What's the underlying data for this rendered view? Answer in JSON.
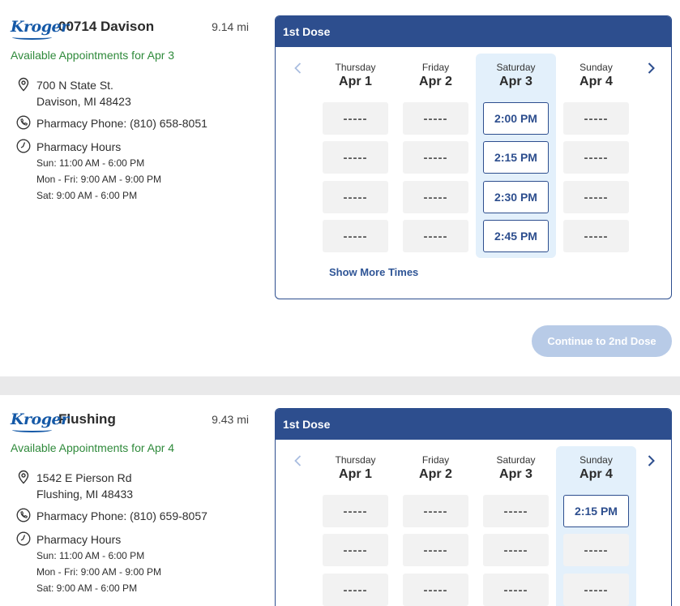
{
  "stores": [
    {
      "name": "00714 Davison",
      "distance": "9.14 mi",
      "available": "Available Appointments for Apr 3",
      "address_line1": "700 N State St.",
      "address_line2": "Davison, MI 48423",
      "phone": "Pharmacy Phone: (810) 658-8051",
      "hours_title": "Pharmacy Hours",
      "hours": [
        "Sun: 11:00 AM - 6:00 PM",
        "Mon - Fri: 9:00 AM - 9:00 PM",
        "Sat: 9:00 AM - 6:00 PM"
      ],
      "dose_label": "1st Dose",
      "show_more": "Show More Times",
      "continue_label": "Continue to 2nd Dose",
      "days": [
        {
          "name": "Thursday",
          "date": "Apr 1",
          "slots": [
            "-----",
            "-----",
            "-----",
            "-----"
          ]
        },
        {
          "name": "Friday",
          "date": "Apr 2",
          "slots": [
            "-----",
            "-----",
            "-----",
            "-----"
          ]
        },
        {
          "name": "Saturday",
          "date": "Apr 3",
          "slots": [
            "2:00 PM",
            "2:15 PM",
            "2:30 PM",
            "2:45 PM"
          ]
        },
        {
          "name": "Sunday",
          "date": "Apr 4",
          "slots": [
            "-----",
            "-----",
            "-----",
            "-----"
          ]
        }
      ]
    },
    {
      "name": "Flushing",
      "distance": "9.43 mi",
      "available": "Available Appointments for Apr 4",
      "address_line1": "1542 E Pierson Rd",
      "address_line2": "Flushing, MI 48433",
      "phone": "Pharmacy Phone: (810) 659-8057",
      "hours_title": "Pharmacy Hours",
      "hours": [
        "Sun: 11:00 AM - 6:00 PM",
        "Mon - Fri: 9:00 AM - 9:00 PM",
        "Sat: 9:00 AM - 6:00 PM"
      ],
      "dose_label": "1st Dose",
      "days": [
        {
          "name": "Thursday",
          "date": "Apr 1",
          "slots": [
            "-----",
            "-----",
            "-----"
          ]
        },
        {
          "name": "Friday",
          "date": "Apr 2",
          "slots": [
            "-----",
            "-----",
            "-----"
          ]
        },
        {
          "name": "Saturday",
          "date": "Apr 3",
          "slots": [
            "-----",
            "-----",
            "-----"
          ]
        },
        {
          "name": "Sunday",
          "date": "Apr 4",
          "slots": [
            "2:15 PM",
            "-----",
            "-----"
          ]
        }
      ]
    }
  ],
  "brand": {
    "logo_text": "Kroger",
    "primary": "#2d4e8e",
    "available_green": "#2f8a3b"
  }
}
